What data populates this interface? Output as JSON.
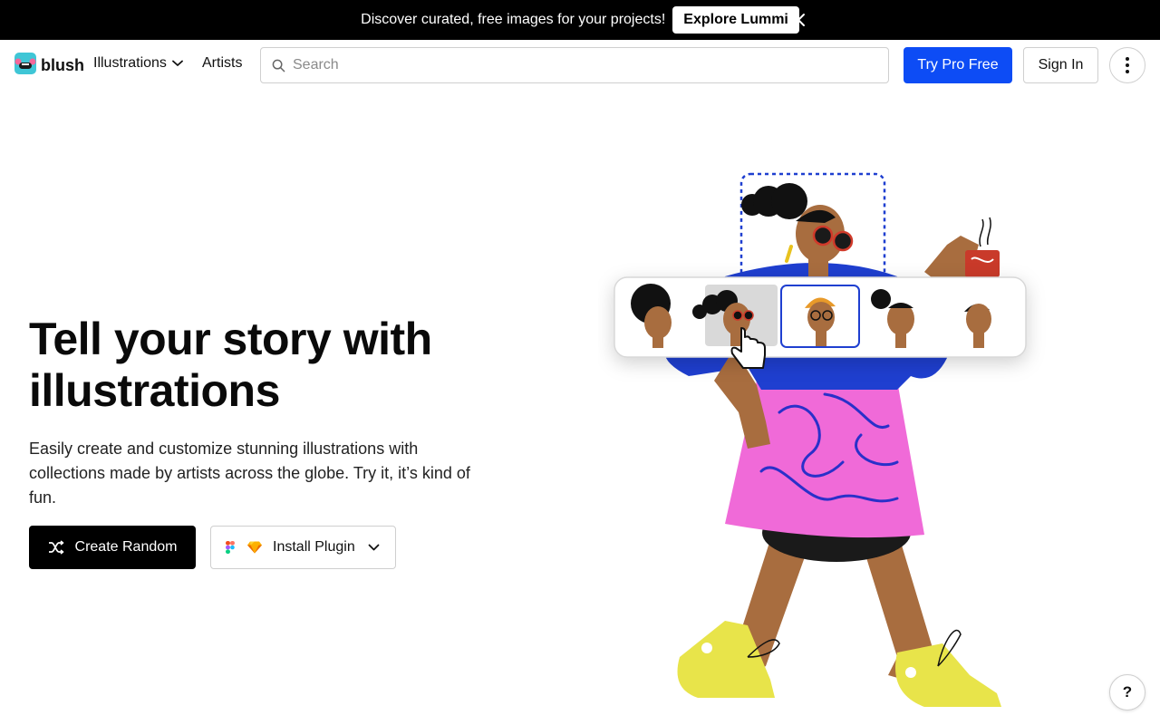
{
  "banner": {
    "text": "Discover curated, free images for your projects!",
    "button_label": "Explore Lummi",
    "close_icon": "close-icon"
  },
  "header": {
    "logo_text": "blush",
    "nav": {
      "illustrations": "Illustrations",
      "artists": "Artists"
    },
    "search": {
      "placeholder": "Search",
      "value": ""
    },
    "try_pro_label": "Try Pro Free",
    "sign_in_label": "Sign In",
    "more_icon": "more-vertical-icon"
  },
  "hero": {
    "title": "Tell your story with illustrations",
    "description": "Easily create and customize stunning illustrations with collections made by artists across the globe. Try it, it’s kind of fun.",
    "create_random_label": "Create Random",
    "install_plugin_label": "Install Plugin"
  },
  "help": {
    "label": "?"
  },
  "colors": {
    "brand_blue": "#0d4cf5",
    "banner_bg": "#000000",
    "skin": "#a86d3f",
    "shirt": "#1f3fd0",
    "skirt": "#f06ad8",
    "shoes": "#e8e44a"
  }
}
